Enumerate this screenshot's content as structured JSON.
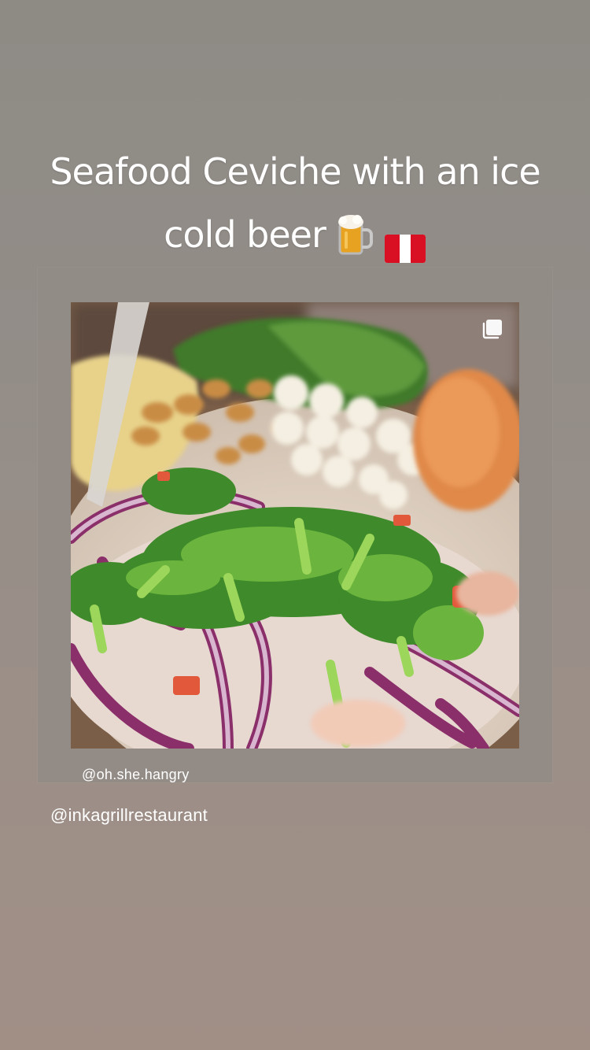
{
  "story": {
    "caption_line1": "Seafood Ceviche with an ice",
    "caption_line2": "cold beer",
    "caption_emojis": [
      "beer-mug-icon",
      "peru-flag-icon"
    ],
    "mention": "@inkagrillrestaurant"
  },
  "shared_post": {
    "author": "@oh.she.hangry",
    "media_icon": "multiple-posts-icon"
  },
  "colors": {
    "background_top": "#8e8b85",
    "background_bottom": "#a18f86",
    "card": "#928c86",
    "text": "#ffffff"
  }
}
